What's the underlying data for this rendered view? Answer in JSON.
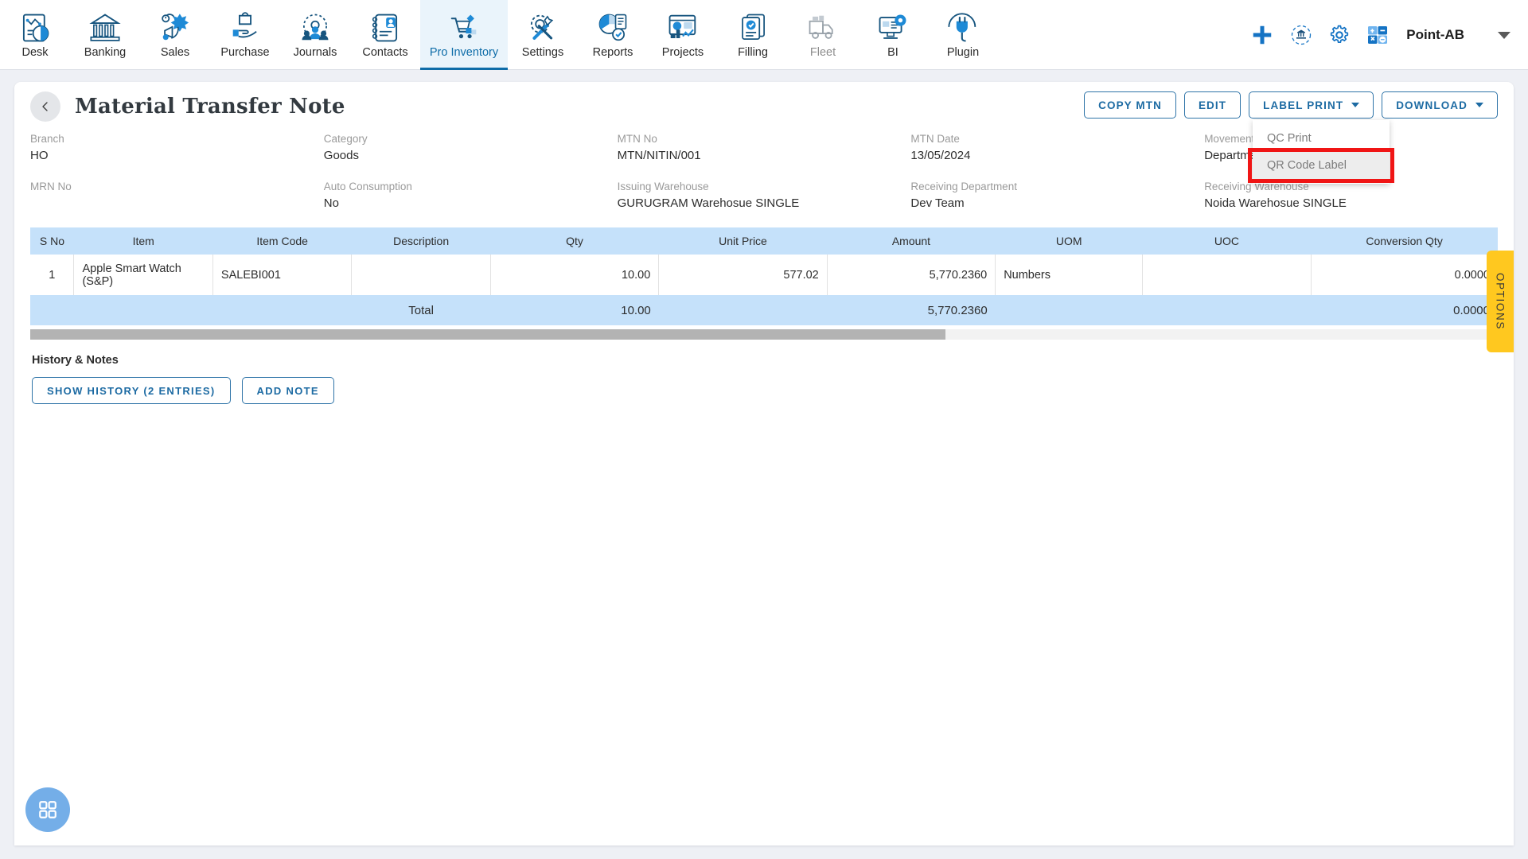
{
  "nav": {
    "items": [
      {
        "label": "Desk",
        "icon": "desk-dashboard-icon",
        "active": false
      },
      {
        "label": "Banking",
        "icon": "bank-building-icon",
        "active": false
      },
      {
        "label": "Sales",
        "icon": "sales-megaphone-icon",
        "active": false
      },
      {
        "label": "Purchase",
        "icon": "purchase-bag-hand-icon",
        "active": false
      },
      {
        "label": "Journals",
        "icon": "journals-gear-people-icon",
        "active": false
      },
      {
        "label": "Contacts",
        "icon": "contacts-book-icon",
        "active": false
      },
      {
        "label": "Pro Inventory",
        "icon": "inventory-cart-icon",
        "active": true
      },
      {
        "label": "Settings",
        "icon": "settings-gear-wrench-icon",
        "active": false
      },
      {
        "label": "Reports",
        "icon": "reports-piechart-icon",
        "active": false
      },
      {
        "label": "Projects",
        "icon": "projects-dashboard-icon",
        "active": false
      },
      {
        "label": "Filling",
        "icon": "filling-documents-icon",
        "active": false
      },
      {
        "label": "Fleet",
        "icon": "fleet-truck-icon",
        "active": false
      },
      {
        "label": "BI",
        "icon": "bi-monitor-gear-icon",
        "active": false
      },
      {
        "label": "Plugin",
        "icon": "plugin-plug-icon",
        "active": false
      }
    ],
    "right": {
      "add_icon": "plus-icon",
      "bank_sync_icon": "bank-refresh-icon",
      "settings_icon": "gear-icon",
      "calculator_icon": "calculator-icon",
      "user_label": "Point-AB",
      "chevron_icon": "chevron-down-icon"
    }
  },
  "header": {
    "back_icon": "chevron-left-icon",
    "title": "Material Transfer Note",
    "buttons": [
      {
        "label": "COPY MTN",
        "has_caret": false
      },
      {
        "label": "EDIT",
        "has_caret": false
      },
      {
        "label": "LABEL PRINT",
        "has_caret": true
      },
      {
        "label": "DOWNLOAD",
        "has_caret": true
      }
    ]
  },
  "label_print_menu": {
    "open": true,
    "items": [
      {
        "label": "QC Print",
        "hovered": false,
        "highlighted": false
      },
      {
        "label": "QR Code Label",
        "hovered": true,
        "highlighted": true
      }
    ],
    "highlight_color": "#f01515"
  },
  "details": {
    "row1": [
      {
        "label": "Branch",
        "value": "HO"
      },
      {
        "label": "Category",
        "value": "Goods"
      },
      {
        "label": "MTN No",
        "value": "MTN/NITIN/001"
      },
      {
        "label": "MTN Date",
        "value": "13/05/2024"
      },
      {
        "label": "Movement Type",
        "value": "Department Warehouse"
      }
    ],
    "row2": [
      {
        "label": "MRN No",
        "value": ""
      },
      {
        "label": "Auto Consumption",
        "value": "No"
      },
      {
        "label": "Issuing Warehouse",
        "value": "GURUGRAM Warehosue SINGLE"
      },
      {
        "label": "Receiving Department",
        "value": "Dev Team"
      },
      {
        "label": "Receiving Warehouse",
        "value": "Noida Warehosue SINGLE"
      }
    ]
  },
  "items_table": {
    "columns": [
      "S No",
      "Item",
      "Item Code",
      "Description",
      "Qty",
      "Unit Price",
      "Amount",
      "UOM",
      "UOC",
      "Conversion Qty"
    ],
    "rows": [
      {
        "s_no": "1",
        "item": "Apple Smart Watch (S&P)",
        "item_code": "SALEBI001",
        "description": "",
        "qty": "10.00",
        "unit_price": "577.02",
        "amount": "5,770.2360",
        "uom": "Numbers",
        "uoc": "",
        "conversion_qty": "0.0000"
      }
    ],
    "total": {
      "label": "Total",
      "qty": "10.00",
      "unit_price": "",
      "amount": "5,770.2360",
      "uom": "",
      "uoc": "",
      "conversion_qty": "0.0000"
    }
  },
  "history": {
    "title": "History & Notes",
    "show_history_label": "SHOW HISTORY (2 ENTRIES)",
    "add_note_label": "ADD NOTE"
  },
  "options_tab": {
    "label": "OPTIONS",
    "color": "#ffc81f"
  },
  "fab": {
    "icon": "apps-grid-icon",
    "color": "#74aee8"
  },
  "colors": {
    "accent": "#1d6ba3",
    "nav_active_bg": "#eaf4fb",
    "table_header_bg": "#c5e1fa",
    "page_bg": "#eef0f5"
  }
}
